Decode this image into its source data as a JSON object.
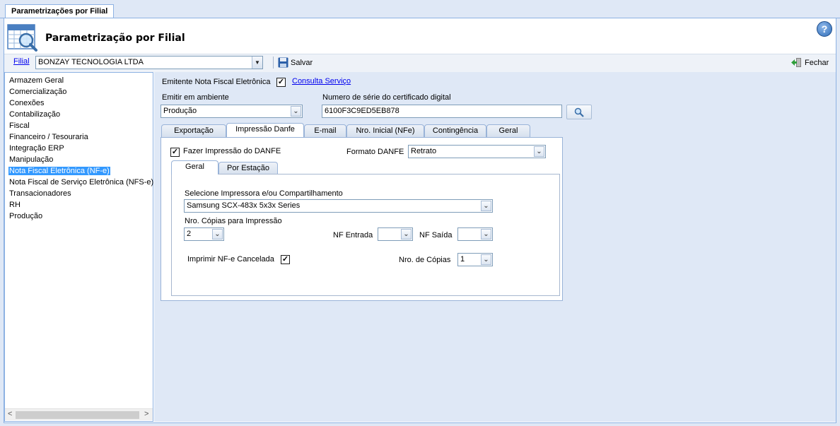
{
  "top_tab": {
    "label": "Parametrizações por Filial"
  },
  "header": {
    "title": "Parametrização por Filial"
  },
  "toolbar": {
    "filial_label": "Filial",
    "filial_value": "BONZAY TECNOLOGIA LTDA",
    "save_label": "Salvar",
    "close_label": "Fechar"
  },
  "sidebar": {
    "items": [
      {
        "label": "Armazem Geral"
      },
      {
        "label": "Comercialização"
      },
      {
        "label": "Conexões"
      },
      {
        "label": "Contabilização"
      },
      {
        "label": "Fiscal"
      },
      {
        "label": "Financeiro / Tesouraria"
      },
      {
        "label": "Integração ERP"
      },
      {
        "label": "Manipulação"
      },
      {
        "label": "Nota Fiscal Eletrônica (NF-e)"
      },
      {
        "label": "Nota Fiscal de Serviço Eletrônica (NFS-e)"
      },
      {
        "label": "Transacionadores"
      },
      {
        "label": "RH"
      },
      {
        "label": "Produção"
      }
    ],
    "selected_index": 8
  },
  "main": {
    "emitente_label": "Emitente Nota Fiscal Eletrônica",
    "emitente_checked": "✓",
    "consulta_link": "Consulta Serviço",
    "ambiente_label": "Emitir em ambiente",
    "ambiente_value": "Produção",
    "serie_label": "Numero de série do certificado digital",
    "serie_value": "6100F3C9ED5EB878",
    "tabs": [
      {
        "label": "Exportação"
      },
      {
        "label": "Impressão Danfe"
      },
      {
        "label": "E-mail"
      },
      {
        "label": "Nro. Inicial (NFe)"
      },
      {
        "label": "Contingência"
      },
      {
        "label": "Geral"
      }
    ],
    "active_tab": "Impressão Danfe",
    "impressao": {
      "fazer_label": "Fazer Impressão do DANFE",
      "fazer_checked": "✓",
      "formato_label": "Formato DANFE",
      "formato_value": "Retrato",
      "subtabs": [
        {
          "label": "Geral"
        },
        {
          "label": "Por Estação"
        }
      ],
      "impressora_label": "Selecione Impressora e/ou Compartilhamento",
      "impressora_value": "Samsung SCX-483x 5x3x Series",
      "copias_label": "Nro. Cópias para Impressão",
      "copias_value": "2",
      "nf_entrada_label": "NF Entrada",
      "nf_entrada_value": "",
      "nf_saida_label": "NF Saída",
      "nf_saida_value": "",
      "cancelada_label": "Imprimir NF-e Cancelada",
      "cancelada_checked": "✓",
      "nro_copias_label": "Nro. de Cópias",
      "nro_copias_value": "1"
    }
  },
  "colors": {
    "background": "#dfe8f6",
    "border": "#8db2e3",
    "selection": "#3399ff",
    "link": "#0000ee"
  }
}
